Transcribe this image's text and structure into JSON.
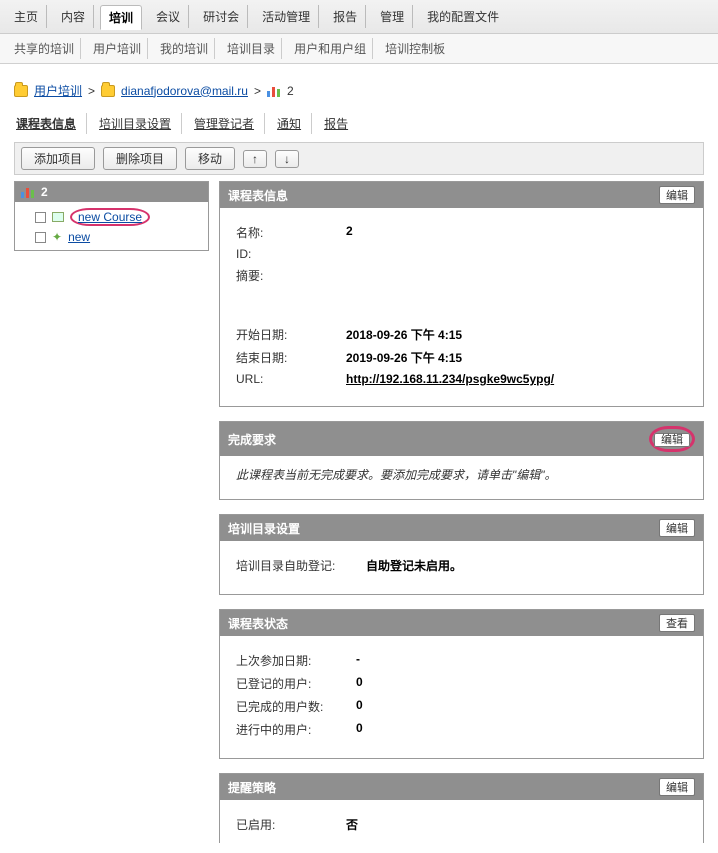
{
  "nav": {
    "tabs": [
      "主页",
      "内容",
      "培训",
      "会议",
      "研讨会",
      "活动管理",
      "报告",
      "管理",
      "我的配置文件"
    ],
    "active_index": 2,
    "subtabs": [
      "共享的培训",
      "用户培训",
      "我的培训",
      "培训目录",
      "用户和用户组",
      "培训控制板"
    ]
  },
  "breadcrumb": {
    "root": "用户培训",
    "link": "dianafjodorova@mail.ru",
    "leaf": "2"
  },
  "page_subtabs": {
    "items": [
      "课程表信息",
      "培训目录设置",
      "管理登记者",
      "通知",
      "报告"
    ],
    "selected_index": 0
  },
  "toolbar": {
    "add": "添加项目",
    "delete": "删除项目",
    "move": "移动",
    "up": "↑",
    "down": "↓"
  },
  "tree": {
    "title": "2",
    "items": [
      {
        "label": "new Course",
        "icon": "book-icon",
        "circled": true
      },
      {
        "label": "new",
        "icon": "piece-icon",
        "circled": false
      }
    ]
  },
  "info_panel": {
    "title": "课程表信息",
    "edit": "编辑",
    "fields": {
      "name_k": "名称:",
      "name_v": "2",
      "id_k": "ID:",
      "id_v": "",
      "summary_k": "摘要:",
      "summary_v": "",
      "start_k": "开始日期:",
      "start_v": "2018-09-26 下午 4:15",
      "end_k": "结束日期:",
      "end_v": "2019-09-26 下午 4:15",
      "url_k": "URL:",
      "url_v": "http://192.168.11.234/psgke9wc5ypg/"
    }
  },
  "completion_panel": {
    "title": "完成要求",
    "edit": "编辑",
    "note": "此课程表当前无完成要求。要添加完成要求，请单击\"编辑\"。"
  },
  "catalog_panel": {
    "title": "培训目录设置",
    "edit": "编辑",
    "row_k": "培训目录自助登记:",
    "row_v": "自助登记未启用。"
  },
  "status_panel": {
    "title": "课程表状态",
    "view": "查看",
    "rows": [
      {
        "k": "上次参加日期:",
        "v": "-"
      },
      {
        "k": "已登记的用户:",
        "v": "0"
      },
      {
        "k": "已完成的用户数:",
        "v": "0"
      },
      {
        "k": "进行中的用户:",
        "v": "0"
      }
    ]
  },
  "reminder_panel": {
    "title": "提醒策略",
    "edit": "编辑",
    "row_k": "已启用:",
    "row_v": "否"
  }
}
